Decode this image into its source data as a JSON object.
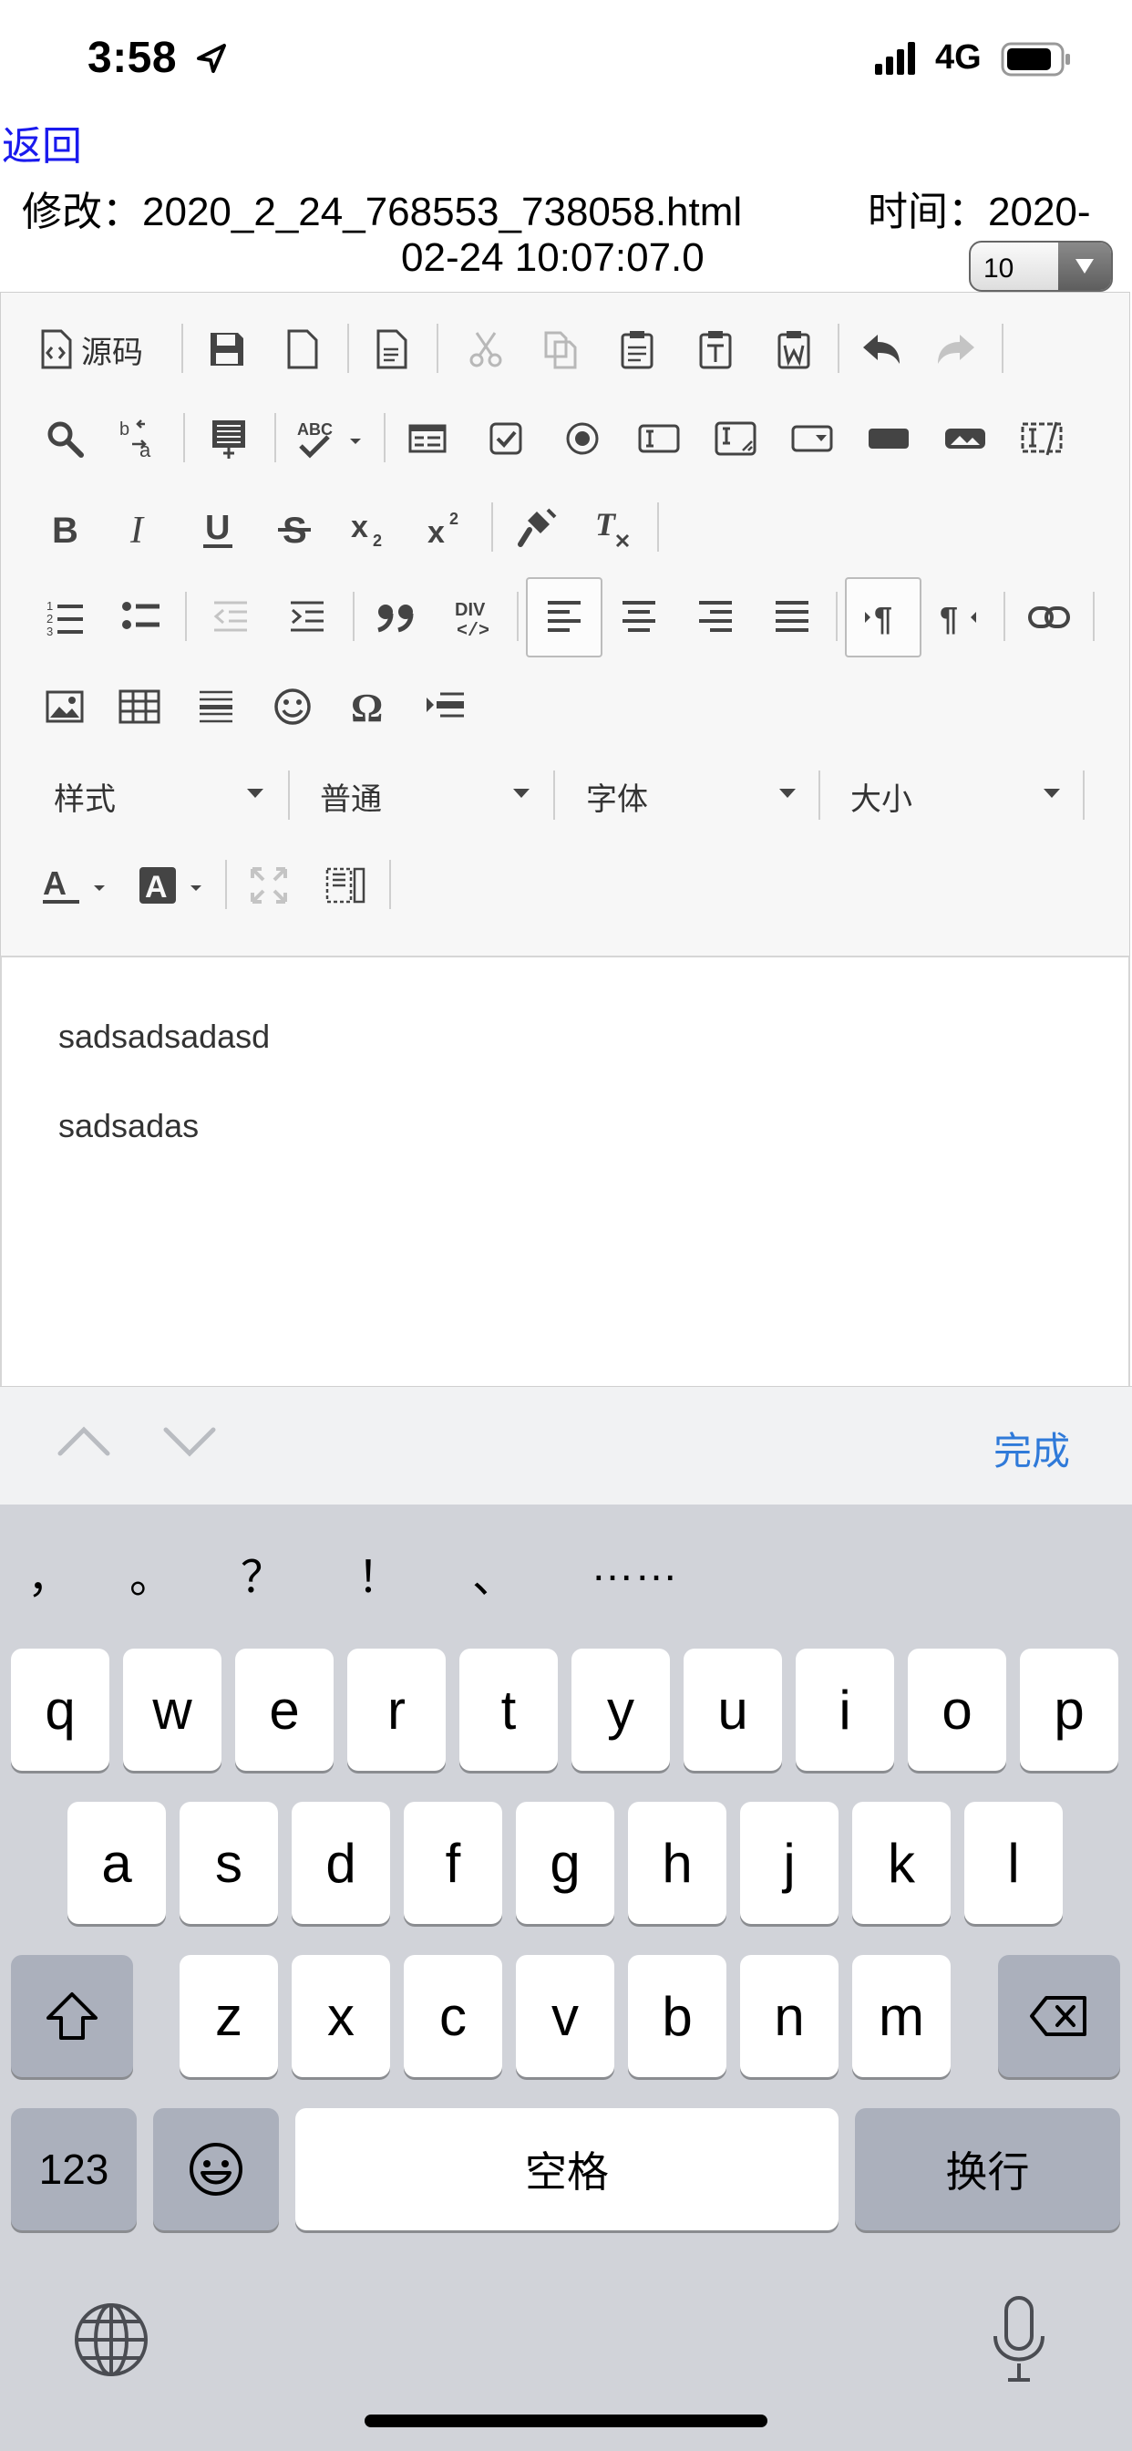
{
  "status_bar": {
    "time": "3:58",
    "network": "4G"
  },
  "header": {
    "back_label": "返回",
    "modify_text": "修改：2020_2_24_768553_738058.html",
    "time_label": "时间：2020-",
    "time_value_cont": "02-24 10:07:07.0",
    "select_value": "10"
  },
  "toolbar": {
    "source_label": "源码",
    "combos": {
      "style": "样式",
      "format": "普通",
      "font": "字体",
      "size": "大小"
    },
    "icons": [
      "source-icon",
      "save-icon",
      "new-page-icon",
      "preview-icon",
      "cut-icon",
      "copy-icon",
      "paste-icon",
      "paste-text-icon",
      "paste-word-icon",
      "undo-icon",
      "redo-icon",
      "find-icon",
      "replace-icon",
      "select-all-icon",
      "spellcheck-icon",
      "form-icon",
      "checkbox-icon",
      "radio-icon",
      "textfield-icon",
      "textarea-icon",
      "select-field-icon",
      "button-icon",
      "image-button-icon",
      "hidden-field-icon",
      "bold-icon",
      "italic-icon",
      "underline-icon",
      "strike-icon",
      "subscript-icon",
      "superscript-icon",
      "copy-format-icon",
      "remove-format-icon",
      "numbered-list-icon",
      "bulleted-list-icon",
      "outdent-icon",
      "indent-icon",
      "blockquote-icon",
      "div-icon",
      "align-left-icon",
      "align-center-icon",
      "align-right-icon",
      "justify-icon",
      "ltr-icon",
      "rtl-icon",
      "link-icon",
      "image-icon",
      "table-icon",
      "horizontal-rule-icon",
      "smiley-icon",
      "special-char-icon",
      "page-break-icon",
      "text-color-icon",
      "bg-color-icon",
      "maximize-icon",
      "show-blocks-icon"
    ]
  },
  "content": {
    "paragraphs": [
      "sadsadsadasd",
      "sadsadas"
    ]
  },
  "accessory": {
    "done_label": "完成"
  },
  "keyboard": {
    "suggestions": [
      "，",
      "。",
      "？",
      "！",
      "、",
      "……"
    ],
    "row1": [
      "q",
      "w",
      "e",
      "r",
      "t",
      "y",
      "u",
      "i",
      "o",
      "p"
    ],
    "row2": [
      "a",
      "s",
      "d",
      "f",
      "g",
      "h",
      "j",
      "k",
      "l"
    ],
    "row3": [
      "z",
      "x",
      "c",
      "v",
      "b",
      "n",
      "m"
    ],
    "numbers_label": "123",
    "space_label": "空格",
    "return_label": "换行"
  }
}
